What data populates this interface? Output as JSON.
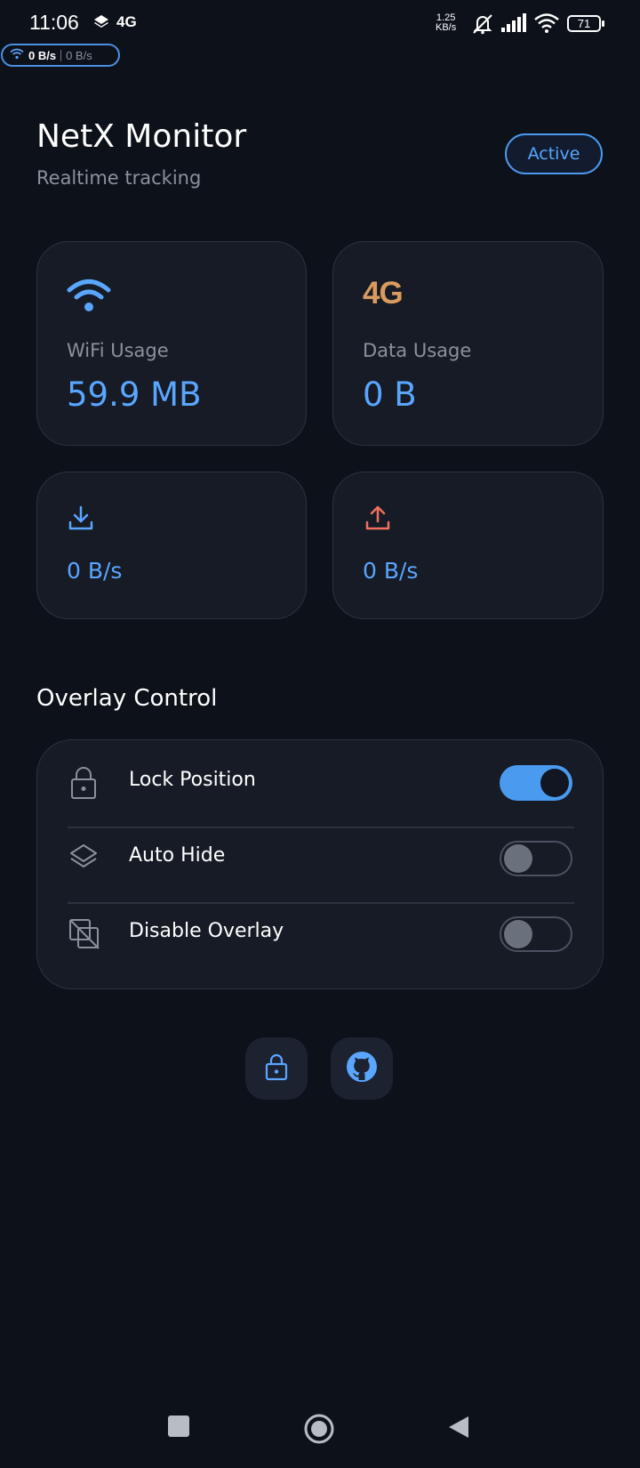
{
  "status_bar": {
    "time": "11:06",
    "network_type": "4G",
    "speed_value": "1.25",
    "speed_unit": "KB/s",
    "battery": "71"
  },
  "speed_pill": {
    "download": "0 B/s",
    "upload": "0 B/s"
  },
  "header": {
    "title": "NetX Monitor",
    "subtitle": "Realtime tracking",
    "status_badge": "Active"
  },
  "usage_cards": {
    "wifi": {
      "label": "WiFi Usage",
      "value": "59.9 MB",
      "icon": "wifi-icon"
    },
    "data": {
      "label": "Data Usage",
      "value": "0 B",
      "badge": "4G"
    }
  },
  "speed_cards": {
    "download": {
      "value": "0 B/s",
      "icon": "download-icon"
    },
    "upload": {
      "value": "0 B/s",
      "icon": "upload-icon"
    }
  },
  "overlay_control": {
    "title": "Overlay Control",
    "items": [
      {
        "label": "Lock Position",
        "icon": "lock-icon",
        "enabled": true
      },
      {
        "label": "Auto Hide",
        "icon": "layers-icon",
        "enabled": false
      },
      {
        "label": "Disable Overlay",
        "icon": "overlay-off-icon",
        "enabled": false
      }
    ]
  },
  "footer_buttons": [
    {
      "icon": "lock-icon"
    },
    {
      "icon": "github-icon"
    }
  ],
  "colors": {
    "accent": "#5aa6ff",
    "upload": "#f07060",
    "badge_4g": "#d99a60",
    "background": "#0d111a",
    "card": "#161b25"
  }
}
